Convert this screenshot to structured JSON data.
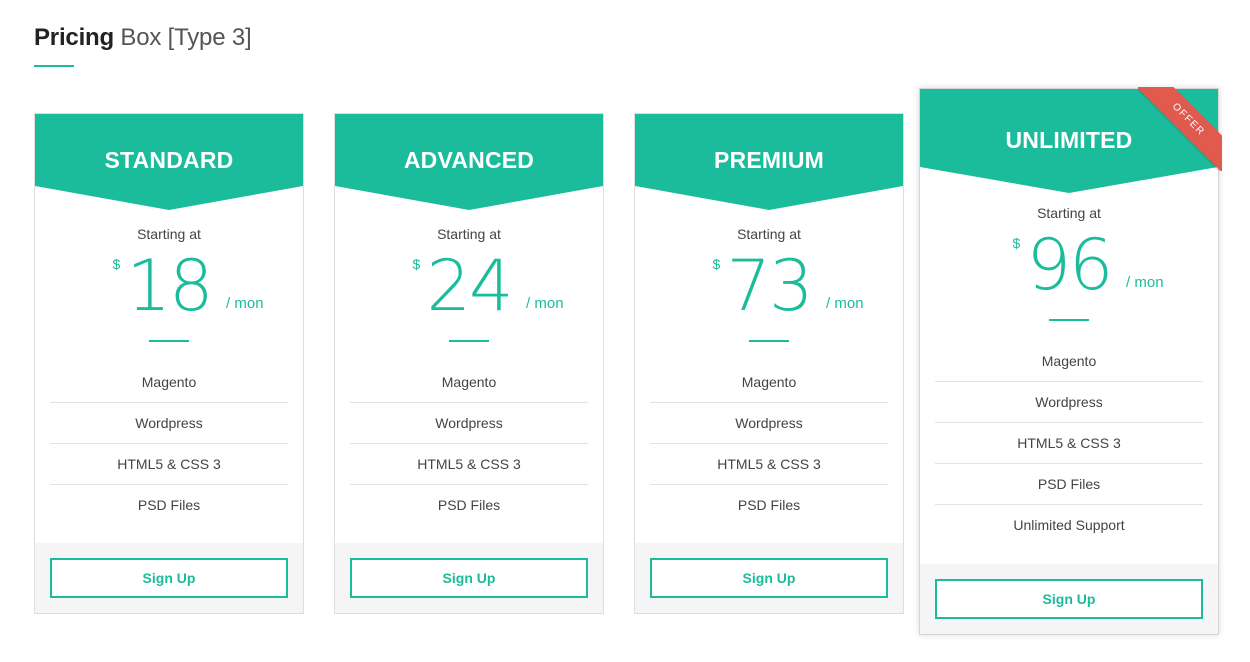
{
  "section": {
    "title_bold": "Pricing",
    "title_light": "Box [Type 3]"
  },
  "colors": {
    "accent": "#1bbc9b",
    "ribbon": "#e05a4e",
    "footer_bg": "#f5f5f5"
  },
  "plans": [
    {
      "name": "STANDARD",
      "starting": "Starting at",
      "currency": "$",
      "price": "18",
      "period": "/ mon",
      "features": [
        "Magento",
        "Wordpress",
        "HTML5 & CSS 3",
        "PSD Files"
      ],
      "button": "Sign Up"
    },
    {
      "name": "ADVANCED",
      "starting": "Starting at",
      "currency": "$",
      "price": "24",
      "period": "/ mon",
      "features": [
        "Magento",
        "Wordpress",
        "HTML5 & CSS 3",
        "PSD Files"
      ],
      "button": "Sign Up"
    },
    {
      "name": "PREMIUM",
      "starting": "Starting at",
      "currency": "$",
      "price": "73",
      "period": "/ mon",
      "features": [
        "Magento",
        "Wordpress",
        "HTML5 & CSS 3",
        "PSD Files"
      ],
      "button": "Sign Up"
    },
    {
      "name": "UNLIMITED",
      "ribbon": "OFFER",
      "starting": "Starting at",
      "currency": "$",
      "price": "96",
      "period": "/ mon",
      "features": [
        "Magento",
        "Wordpress",
        "HTML5 & CSS 3",
        "PSD Files",
        "Unlimited Support"
      ],
      "button": "Sign Up"
    }
  ]
}
